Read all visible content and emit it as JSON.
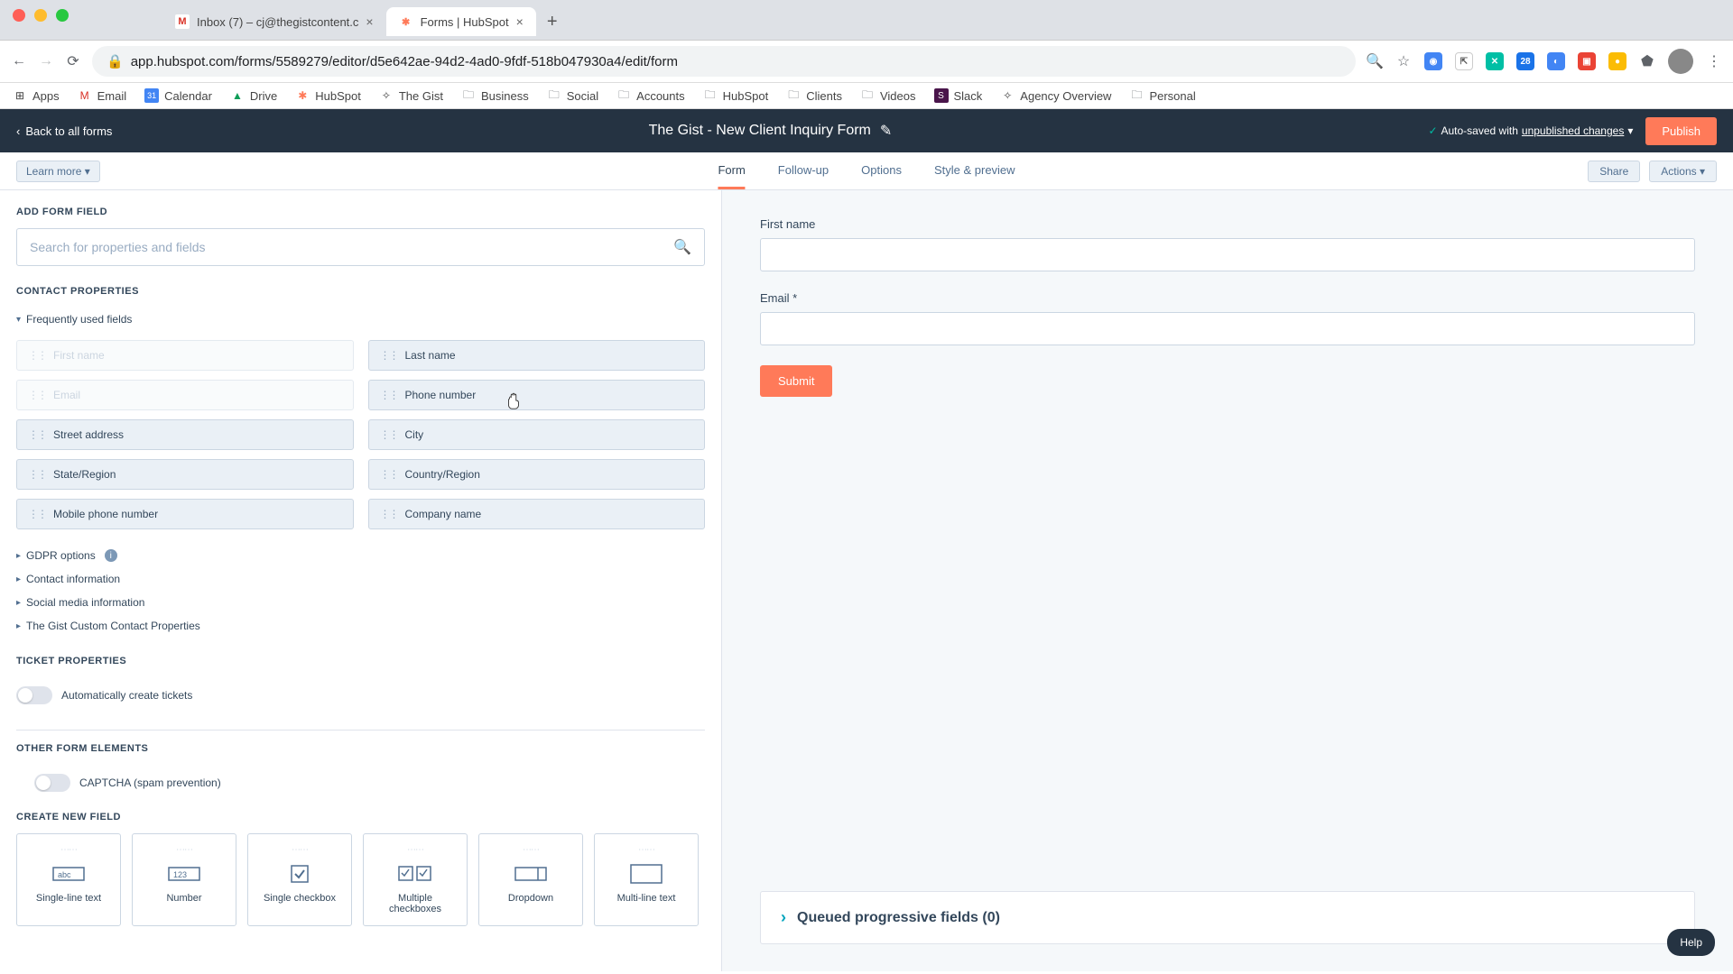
{
  "browser": {
    "tabs": [
      {
        "title": "Inbox (7) – cj@thegistcontent.c",
        "favicon": "M",
        "faviconColor": "#d93025"
      },
      {
        "title": "Forms | HubSpot",
        "favicon": "H",
        "faviconColor": "#ff7a59"
      }
    ],
    "url": "app.hubspot.com/forms/5589279/editor/d5e642ae-94d2-4ad0-9fdf-518b047930a4/edit/form",
    "bookmarks": [
      {
        "label": "Apps",
        "icon": "⊞"
      },
      {
        "label": "Email",
        "icon": "M"
      },
      {
        "label": "Calendar",
        "icon": "31"
      },
      {
        "label": "Drive",
        "icon": "▲"
      },
      {
        "label": "HubSpot",
        "icon": "H"
      },
      {
        "label": "The Gist",
        "icon": "G"
      },
      {
        "label": "Business",
        "icon": "📁"
      },
      {
        "label": "Social",
        "icon": "📁"
      },
      {
        "label": "Accounts",
        "icon": "📁"
      },
      {
        "label": "HubSpot",
        "icon": "📁"
      },
      {
        "label": "Clients",
        "icon": "📁"
      },
      {
        "label": "Videos",
        "icon": "📁"
      },
      {
        "label": "Slack",
        "icon": "S"
      },
      {
        "label": "Agency Overview",
        "icon": "A"
      },
      {
        "label": "Personal",
        "icon": "📁"
      }
    ]
  },
  "header": {
    "back_label": "Back to all forms",
    "title": "The Gist - New Client Inquiry Form",
    "autosave_prefix": "Auto-saved with ",
    "autosave_link": "unpublished changes",
    "publish": "Publish"
  },
  "subbar": {
    "learn_more": "Learn more",
    "tabs": [
      "Form",
      "Follow-up",
      "Options",
      "Style & preview"
    ],
    "share": "Share",
    "actions": "Actions"
  },
  "left": {
    "add_heading": "ADD FORM FIELD",
    "search_placeholder": "Search for properties and fields",
    "contact_heading": "CONTACT PROPERTIES",
    "freq_label": "Frequently used fields",
    "fields": [
      {
        "label": "First name",
        "disabled": true
      },
      {
        "label": "Last name",
        "disabled": false
      },
      {
        "label": "Email",
        "disabled": true
      },
      {
        "label": "Phone number",
        "disabled": false
      },
      {
        "label": "Street address",
        "disabled": false
      },
      {
        "label": "City",
        "disabled": false
      },
      {
        "label": "State/Region",
        "disabled": false
      },
      {
        "label": "Country/Region",
        "disabled": false
      },
      {
        "label": "Mobile phone number",
        "disabled": false
      },
      {
        "label": "Company name",
        "disabled": false
      }
    ],
    "groups": [
      "GDPR options",
      "Contact information",
      "Social media information",
      "The Gist Custom Contact Properties"
    ],
    "ticket_heading": "TICKET PROPERTIES",
    "ticket_toggle": "Automatically create tickets",
    "other_heading": "OTHER FORM ELEMENTS",
    "captcha": "CAPTCHA (spam prevention)",
    "create_heading": "CREATE NEW FIELD",
    "new_fields": [
      {
        "label": "Single-line text",
        "icon": "abc"
      },
      {
        "label": "Number",
        "icon": "123"
      },
      {
        "label": "Single checkbox",
        "icon": "☑"
      },
      {
        "label": "Multiple checkboxes",
        "icon": "☑☑"
      },
      {
        "label": "Dropdown",
        "icon": "▭"
      },
      {
        "label": "Multi-line text",
        "icon": "▭"
      }
    ]
  },
  "preview": {
    "fields": [
      {
        "label": "First name",
        "required": false
      },
      {
        "label": "Email",
        "required": true
      }
    ],
    "submit": "Submit",
    "queued": "Queued progressive fields (0)"
  },
  "help": "Help"
}
